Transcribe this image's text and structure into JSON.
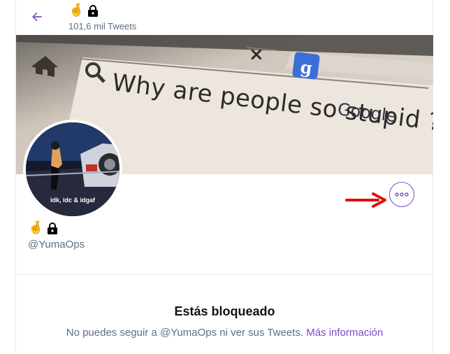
{
  "header": {
    "name_emoji": "🤞",
    "tweet_count": "101,6 mil Tweets"
  },
  "banner": {
    "search_text": "Why are people so stupid ?",
    "google_label": "Google",
    "g_letter": "g",
    "tab_close": "×"
  },
  "avatar": {
    "caption": "idk, idc & idgaf"
  },
  "profile": {
    "name_emoji": "🤞",
    "handle": "@YumaOps"
  },
  "blocked": {
    "title": "Estás bloqueado",
    "message": "No puedes seguir a @YumaOps ni ver sus Tweets.",
    "link": "Más información"
  },
  "colors": {
    "accent": "#794bc4",
    "annotation_arrow": "#e01010",
    "secondary_text": "#5b7083"
  },
  "icons": {
    "back": "back-arrow-icon",
    "lock": "lock-icon",
    "more": "more-options-icon"
  }
}
